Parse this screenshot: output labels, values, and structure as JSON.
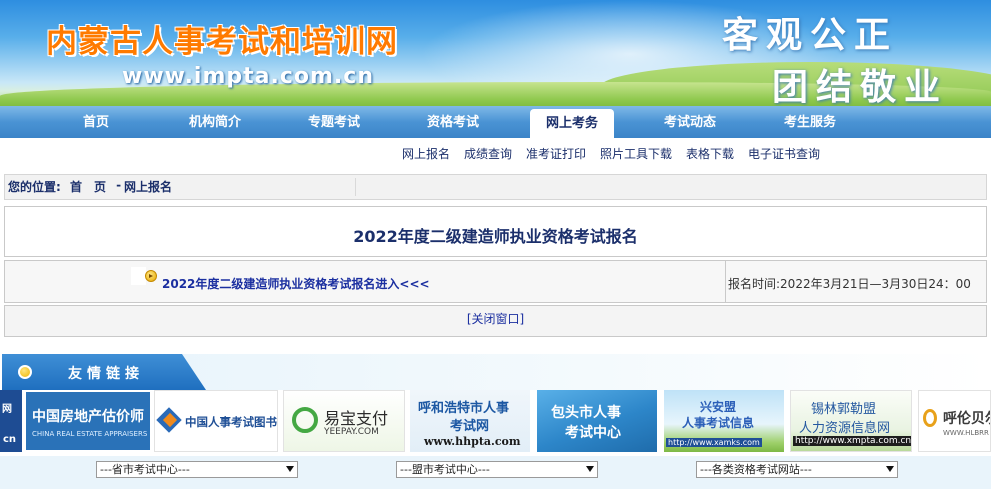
{
  "banner": {
    "site_title": "内蒙古人事考试和培训网",
    "site_url": "www.impta.com.cn",
    "slogan_line1": "客观公正",
    "slogan_line2": "团结敬业"
  },
  "main_nav": {
    "active_index": 4,
    "items": [
      {
        "label": "首页"
      },
      {
        "label": "机构简介"
      },
      {
        "label": "专题考试"
      },
      {
        "label": "资格考试"
      },
      {
        "label": "网上考务"
      },
      {
        "label": "考试动态"
      },
      {
        "label": "考生服务"
      }
    ]
  },
  "sub_nav": {
    "items": [
      {
        "label": "网上报名"
      },
      {
        "label": "成绩查询"
      },
      {
        "label": "准考证打印"
      },
      {
        "label": "照片工具下载"
      },
      {
        "label": "表格下载"
      },
      {
        "label": "电子证书查询"
      }
    ]
  },
  "breadcrumb": {
    "label": "您的位置:",
    "home": "首　页",
    "separator": " - ",
    "current": "网上报名"
  },
  "content": {
    "page_title": "2022年度二级建造师执业资格考试报名",
    "registration_link": "2022年度二级建造师执业资格考试报名进入<<<",
    "registration_time": "报名时间:2022年3月21日—3月30日24：00",
    "close_window": "[关闭窗口]"
  },
  "friend_links": {
    "heading": "友情链接",
    "logos": [
      {
        "icon": "partial-logo",
        "text_a": "网",
        "text_b": "cn"
      },
      {
        "icon": "real-estate-appraisers-logo",
        "text_a": "中国房地产估价师",
        "text_b": "CHINA REAL ESTATE APPRAISERS"
      },
      {
        "icon": "cpta-bookstore-logo",
        "text_a": "中国人事考试图书网"
      },
      {
        "icon": "yeepay-logo",
        "text_a": "易宝支付",
        "text_b": "YEEPAY.COM"
      },
      {
        "icon": "hhpta-logo",
        "text_a": "呼和浩特市人事",
        "text_b": "考试网",
        "text_c": "www.hhpta.com"
      },
      {
        "icon": "baotou-exam-logo",
        "text_a": "包头市人事",
        "text_b": "考试中心"
      },
      {
        "icon": "xinganmeng-exam-logo",
        "text_a": "兴安盟",
        "text_b": "人事考试信息",
        "text_c": "http://www.xamks.com"
      },
      {
        "icon": "xilinguole-hr-logo",
        "text_a": "锡林郭勒盟",
        "text_b": "人力资源信息网",
        "text_c": "http://www.xmpta.com.cn"
      },
      {
        "icon": "hulunbuir-logo",
        "text_a": "呼伦贝尔",
        "text_b": "WWW.HLBRR"
      }
    ]
  },
  "selects": [
    {
      "selected": "---省市考试中心---"
    },
    {
      "selected": "---盟市考试中心---"
    },
    {
      "selected": "---各类资格考试网站---"
    }
  ],
  "colors": {
    "nav_blue": "#4a93d4",
    "title_navy": "#1b2f6b",
    "link_blue": "#1b2fa0",
    "logo_orange": "#ff7a00"
  }
}
